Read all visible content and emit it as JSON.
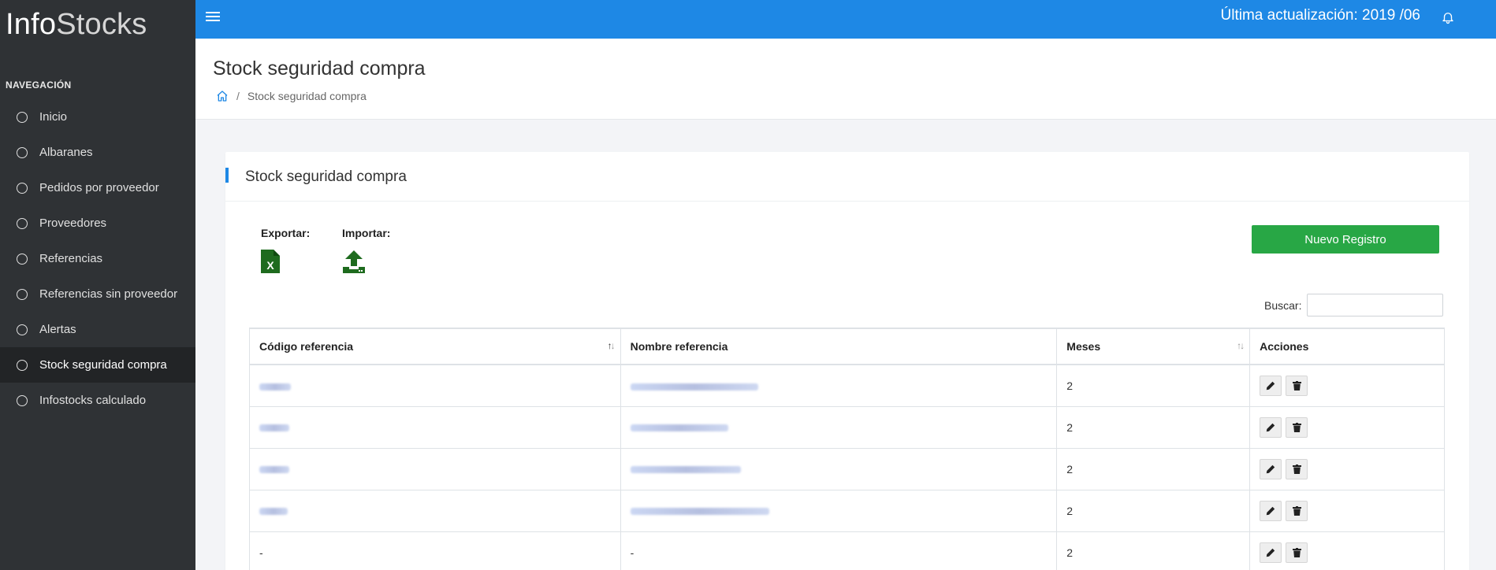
{
  "app": {
    "logo_part1": "Info",
    "logo_part2": "Stocks"
  },
  "topbar": {
    "update_text": "Última actualización: 2019 /06"
  },
  "sidebar": {
    "heading": "NAVEGACIÓN",
    "items": [
      {
        "label": "Inicio"
      },
      {
        "label": "Albaranes"
      },
      {
        "label": "Pedidos por proveedor"
      },
      {
        "label": "Proveedores"
      },
      {
        "label": "Referencias"
      },
      {
        "label": "Referencias sin proveedor"
      },
      {
        "label": "Alertas"
      },
      {
        "label": "Stock seguridad compra"
      },
      {
        "label": "Infostocks calculado"
      }
    ]
  },
  "page": {
    "title": "Stock seguridad compra",
    "breadcrumb_current": "Stock seguridad compra"
  },
  "card": {
    "title": "Stock seguridad compra",
    "export_label": "Exportar:",
    "import_label": "Importar:",
    "new_button": "Nuevo Registro",
    "search_label": "Buscar:",
    "search_value": ""
  },
  "table": {
    "headers": [
      "Código referencia",
      "Nombre referencia",
      "Meses",
      "Acciones"
    ],
    "rows": [
      {
        "codigo": "",
        "nombre": "",
        "meses": "2"
      },
      {
        "codigo": "",
        "nombre": "",
        "meses": "2"
      },
      {
        "codigo": "",
        "nombre": "",
        "meses": "2"
      },
      {
        "codigo": "",
        "nombre": "",
        "meses": "2"
      },
      {
        "codigo": "-",
        "nombre": "-",
        "meses": "2"
      }
    ]
  },
  "colors": {
    "primary": "#1e88e5",
    "sidebar_bg": "#2f3235",
    "sidebar_active": "#222426",
    "success": "#28a745",
    "excel_green": "#1e6b1e"
  },
  "icons": {
    "menu": "hamburger-icon",
    "notifications": "bell-icon",
    "home": "home-icon",
    "export": "excel-file-icon",
    "import": "upload-icon",
    "edit": "pencil-icon",
    "delete": "trash-icon"
  }
}
